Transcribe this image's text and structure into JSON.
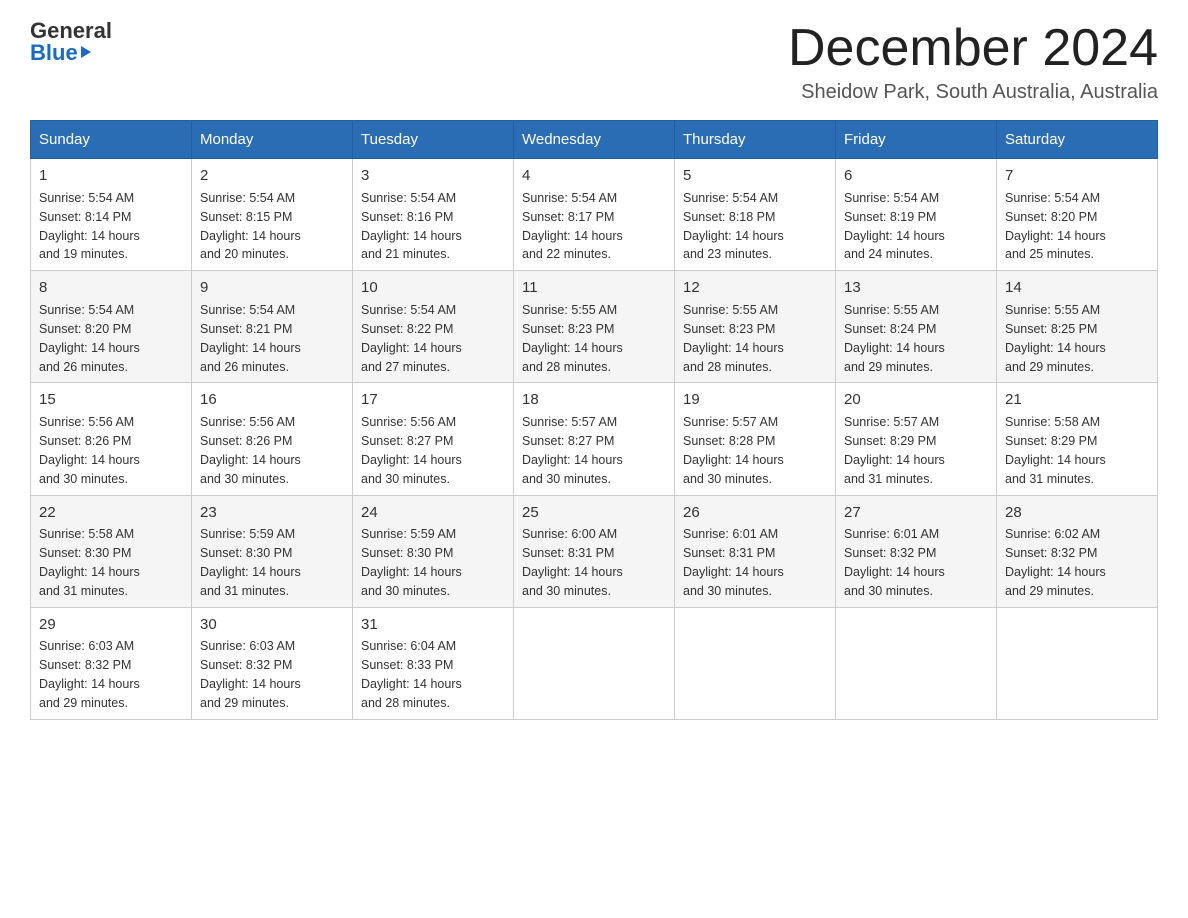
{
  "header": {
    "logo_general": "General",
    "logo_blue": "Blue",
    "month_title": "December 2024",
    "location": "Sheidow Park, South Australia, Australia"
  },
  "days_of_week": [
    "Sunday",
    "Monday",
    "Tuesday",
    "Wednesday",
    "Thursday",
    "Friday",
    "Saturday"
  ],
  "weeks": [
    [
      {
        "day": "1",
        "sunrise": "5:54 AM",
        "sunset": "8:14 PM",
        "daylight": "14 hours and 19 minutes."
      },
      {
        "day": "2",
        "sunrise": "5:54 AM",
        "sunset": "8:15 PM",
        "daylight": "14 hours and 20 minutes."
      },
      {
        "day": "3",
        "sunrise": "5:54 AM",
        "sunset": "8:16 PM",
        "daylight": "14 hours and 21 minutes."
      },
      {
        "day": "4",
        "sunrise": "5:54 AM",
        "sunset": "8:17 PM",
        "daylight": "14 hours and 22 minutes."
      },
      {
        "day": "5",
        "sunrise": "5:54 AM",
        "sunset": "8:18 PM",
        "daylight": "14 hours and 23 minutes."
      },
      {
        "day": "6",
        "sunrise": "5:54 AM",
        "sunset": "8:19 PM",
        "daylight": "14 hours and 24 minutes."
      },
      {
        "day": "7",
        "sunrise": "5:54 AM",
        "sunset": "8:20 PM",
        "daylight": "14 hours and 25 minutes."
      }
    ],
    [
      {
        "day": "8",
        "sunrise": "5:54 AM",
        "sunset": "8:20 PM",
        "daylight": "14 hours and 26 minutes."
      },
      {
        "day": "9",
        "sunrise": "5:54 AM",
        "sunset": "8:21 PM",
        "daylight": "14 hours and 26 minutes."
      },
      {
        "day": "10",
        "sunrise": "5:54 AM",
        "sunset": "8:22 PM",
        "daylight": "14 hours and 27 minutes."
      },
      {
        "day": "11",
        "sunrise": "5:55 AM",
        "sunset": "8:23 PM",
        "daylight": "14 hours and 28 minutes."
      },
      {
        "day": "12",
        "sunrise": "5:55 AM",
        "sunset": "8:23 PM",
        "daylight": "14 hours and 28 minutes."
      },
      {
        "day": "13",
        "sunrise": "5:55 AM",
        "sunset": "8:24 PM",
        "daylight": "14 hours and 29 minutes."
      },
      {
        "day": "14",
        "sunrise": "5:55 AM",
        "sunset": "8:25 PM",
        "daylight": "14 hours and 29 minutes."
      }
    ],
    [
      {
        "day": "15",
        "sunrise": "5:56 AM",
        "sunset": "8:26 PM",
        "daylight": "14 hours and 30 minutes."
      },
      {
        "day": "16",
        "sunrise": "5:56 AM",
        "sunset": "8:26 PM",
        "daylight": "14 hours and 30 minutes."
      },
      {
        "day": "17",
        "sunrise": "5:56 AM",
        "sunset": "8:27 PM",
        "daylight": "14 hours and 30 minutes."
      },
      {
        "day": "18",
        "sunrise": "5:57 AM",
        "sunset": "8:27 PM",
        "daylight": "14 hours and 30 minutes."
      },
      {
        "day": "19",
        "sunrise": "5:57 AM",
        "sunset": "8:28 PM",
        "daylight": "14 hours and 30 minutes."
      },
      {
        "day": "20",
        "sunrise": "5:57 AM",
        "sunset": "8:29 PM",
        "daylight": "14 hours and 31 minutes."
      },
      {
        "day": "21",
        "sunrise": "5:58 AM",
        "sunset": "8:29 PM",
        "daylight": "14 hours and 31 minutes."
      }
    ],
    [
      {
        "day": "22",
        "sunrise": "5:58 AM",
        "sunset": "8:30 PM",
        "daylight": "14 hours and 31 minutes."
      },
      {
        "day": "23",
        "sunrise": "5:59 AM",
        "sunset": "8:30 PM",
        "daylight": "14 hours and 31 minutes."
      },
      {
        "day": "24",
        "sunrise": "5:59 AM",
        "sunset": "8:30 PM",
        "daylight": "14 hours and 30 minutes."
      },
      {
        "day": "25",
        "sunrise": "6:00 AM",
        "sunset": "8:31 PM",
        "daylight": "14 hours and 30 minutes."
      },
      {
        "day": "26",
        "sunrise": "6:01 AM",
        "sunset": "8:31 PM",
        "daylight": "14 hours and 30 minutes."
      },
      {
        "day": "27",
        "sunrise": "6:01 AM",
        "sunset": "8:32 PM",
        "daylight": "14 hours and 30 minutes."
      },
      {
        "day": "28",
        "sunrise": "6:02 AM",
        "sunset": "8:32 PM",
        "daylight": "14 hours and 29 minutes."
      }
    ],
    [
      {
        "day": "29",
        "sunrise": "6:03 AM",
        "sunset": "8:32 PM",
        "daylight": "14 hours and 29 minutes."
      },
      {
        "day": "30",
        "sunrise": "6:03 AM",
        "sunset": "8:32 PM",
        "daylight": "14 hours and 29 minutes."
      },
      {
        "day": "31",
        "sunrise": "6:04 AM",
        "sunset": "8:33 PM",
        "daylight": "14 hours and 28 minutes."
      },
      null,
      null,
      null,
      null
    ]
  ],
  "labels": {
    "sunrise": "Sunrise:",
    "sunset": "Sunset:",
    "daylight": "Daylight:"
  }
}
